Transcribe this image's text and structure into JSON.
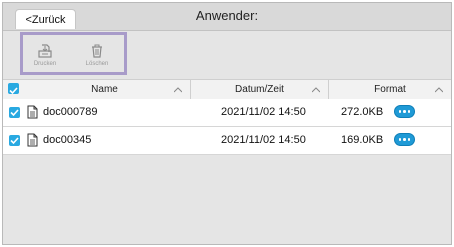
{
  "topbar": {
    "back_label": "<Zurück",
    "title": "Anwender:"
  },
  "actions": {
    "print_label": "Drucken",
    "delete_label": "Löschen"
  },
  "table": {
    "columns": [
      "Name",
      "Datum/Zeit",
      "Format"
    ],
    "rows": [
      {
        "name": "doc000789",
        "datetime": "2021/11/02 14:50",
        "size": "272.0KB",
        "checked": true
      },
      {
        "name": "doc00345",
        "datetime": "2021/11/02 14:50",
        "size": "169.0KB",
        "checked": true
      }
    ]
  },
  "colors": {
    "accent": "#29a9e1",
    "selection_border": "#a89bc9"
  },
  "icons": [
    "print-icon",
    "trash-icon",
    "document-icon",
    "more-icon",
    "sort-chevron-icon",
    "check-icon"
  ]
}
